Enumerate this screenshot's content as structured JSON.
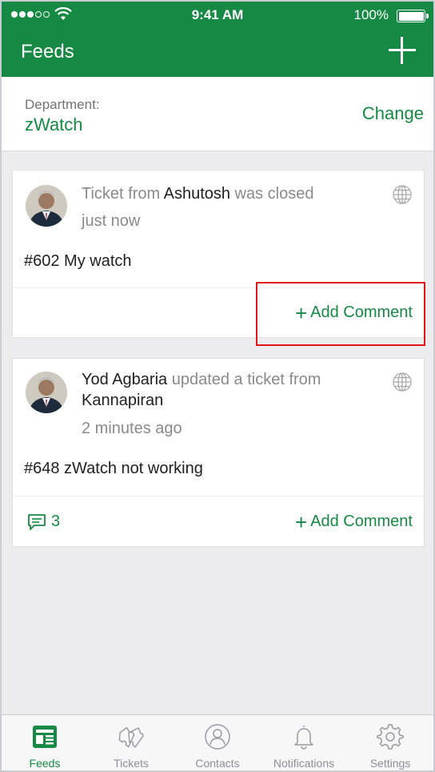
{
  "status_bar": {
    "time": "9:41 AM",
    "battery": "100%"
  },
  "header": {
    "title": "Feeds"
  },
  "department": {
    "label": "Department:",
    "value": "zWatch",
    "change_label": "Change"
  },
  "feed": [
    {
      "prefix": "Ticket from ",
      "actor": "Ashutosh",
      "suffix": " was closed",
      "time": "just now",
      "subject": "#602 My watch",
      "add_comment": "Add Comment"
    },
    {
      "actor": "Yod Agbaria",
      "middle": " updated a ticket from ",
      "target": "Kannapiran",
      "time": "2 minutes ago",
      "subject": "#648 zWatch not working",
      "comment_count": "3",
      "add_comment": "Add Comment"
    }
  ],
  "tabs": [
    {
      "label": "Feeds",
      "icon": "feeds-icon",
      "active": true
    },
    {
      "label": "Tickets",
      "icon": "tickets-icon"
    },
    {
      "label": "Contacts",
      "icon": "contacts-icon"
    },
    {
      "label": "Notifications",
      "icon": "bell-icon"
    },
    {
      "label": "Settings",
      "icon": "gear-icon"
    }
  ],
  "colors": {
    "brand": "#168a44",
    "highlight": "#e0161b"
  }
}
